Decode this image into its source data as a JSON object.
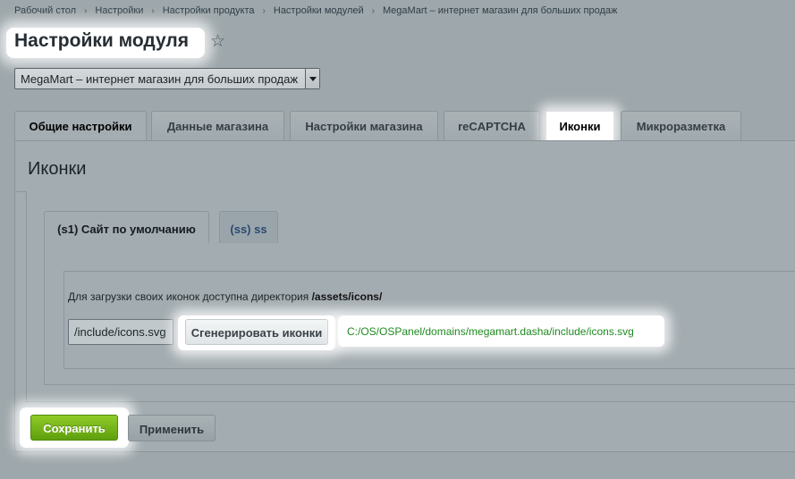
{
  "breadcrumb": {
    "items": [
      "Рабочий стол",
      "Настройки",
      "Настройки продукта",
      "Настройки модулей",
      "MegaMart – интернет магазин для больших продаж"
    ],
    "separator": "›"
  },
  "header": {
    "title": "Настройки модуля",
    "star_icon": "☆"
  },
  "site_select": {
    "value": "MegaMart – интернет магазин для больших продаж"
  },
  "tabs": [
    {
      "label": "Общие настройки"
    },
    {
      "label": "Данные магазина"
    },
    {
      "label": "Настройки магазина"
    },
    {
      "label": "reCAPTCHA"
    },
    {
      "label": "Иконки"
    },
    {
      "label": "Микроразметка"
    }
  ],
  "panel": {
    "title": "Иконки",
    "subtabs": [
      {
        "label": "(s1) Сайт по умолчанию"
      },
      {
        "label": "(ss) ss"
      }
    ],
    "info_text": "Для загрузки своих иконок доступна директория",
    "info_dir": "/assets/icons/",
    "path_input_value": "/include/icons.svg",
    "generate_button": "Сгенерировать иконки",
    "result_path": "C:/OS/OSPanel/domains/megamart.dasha/include/icons.svg"
  },
  "footer": {
    "save_label": "Сохранить",
    "apply_label": "Применить"
  },
  "colors": {
    "accent_green": "#6ab01a",
    "path_green": "#1f8a1f",
    "highlight": "#ffffff"
  }
}
